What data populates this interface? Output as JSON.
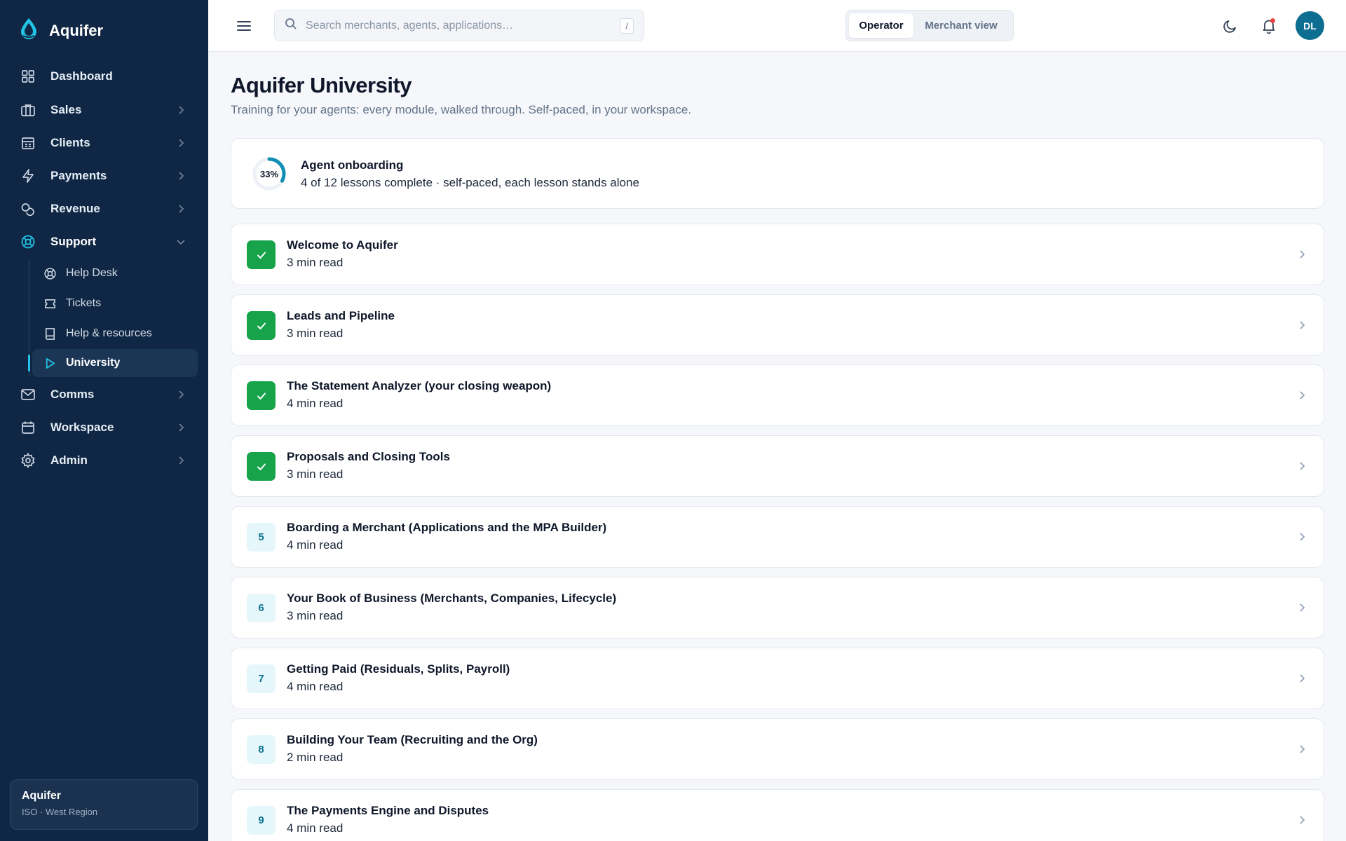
{
  "app": {
    "name": "Aquifer"
  },
  "sidebar": {
    "items": [
      {
        "label": "Dashboard",
        "icon": "grid-icon"
      },
      {
        "label": "Sales",
        "icon": "briefcase-icon"
      },
      {
        "label": "Clients",
        "icon": "building-icon"
      },
      {
        "label": "Payments",
        "icon": "lightning-icon"
      },
      {
        "label": "Revenue",
        "icon": "coins-icon"
      },
      {
        "label": "Support",
        "icon": "lifebuoy-icon"
      },
      {
        "label": "Comms",
        "icon": "mail-icon"
      },
      {
        "label": "Workspace",
        "icon": "calendar-icon"
      },
      {
        "label": "Admin",
        "icon": "gear-icon"
      }
    ],
    "support_children": [
      {
        "label": "Help Desk",
        "icon": "lifebuoy-icon"
      },
      {
        "label": "Tickets",
        "icon": "ticket-icon"
      },
      {
        "label": "Help & resources",
        "icon": "book-icon"
      },
      {
        "label": "University",
        "icon": "play-icon"
      }
    ],
    "org": {
      "name": "Aquifer",
      "subtitle": "ISO · West Region"
    }
  },
  "topbar": {
    "search_placeholder": "Search merchants, agents, applications…",
    "search_shortcut": "/",
    "view_toggle": {
      "selected": "Operator",
      "other": "Merchant view"
    },
    "avatar_initials": "DL"
  },
  "page": {
    "title": "Aquifer University",
    "subtitle": "Training for your agents: every module, walked through. Self-paced, in your workspace."
  },
  "progress": {
    "percent_label": "33%",
    "percent": 33,
    "title": "Agent onboarding",
    "summary": "4 of 12 lessons complete · self-paced, each lesson stands alone"
  },
  "lessons": [
    {
      "number": "1",
      "title": "Welcome to Aquifer",
      "meta": "3 min read",
      "done": true
    },
    {
      "number": "2",
      "title": "Leads and Pipeline",
      "meta": "3 min read",
      "done": true
    },
    {
      "number": "3",
      "title": "The Statement Analyzer (your closing weapon)",
      "meta": "4 min read",
      "done": true
    },
    {
      "number": "4",
      "title": "Proposals and Closing Tools",
      "meta": "3 min read",
      "done": true
    },
    {
      "number": "5",
      "title": "Boarding a Merchant (Applications and the MPA Builder)",
      "meta": "4 min read",
      "done": false
    },
    {
      "number": "6",
      "title": "Your Book of Business (Merchants, Companies, Lifecycle)",
      "meta": "3 min read",
      "done": false
    },
    {
      "number": "7",
      "title": "Getting Paid (Residuals, Splits, Payroll)",
      "meta": "4 min read",
      "done": false
    },
    {
      "number": "8",
      "title": "Building Your Team (Recruiting and the Org)",
      "meta": "2 min read",
      "done": false
    },
    {
      "number": "9",
      "title": "The Payments Engine and Disputes",
      "meta": "4 min read",
      "done": false
    }
  ],
  "colors": {
    "sidebar": "#0f2744",
    "accent": "#22c3e6",
    "done": "#16a34a",
    "avatar": "#0e6e91"
  }
}
